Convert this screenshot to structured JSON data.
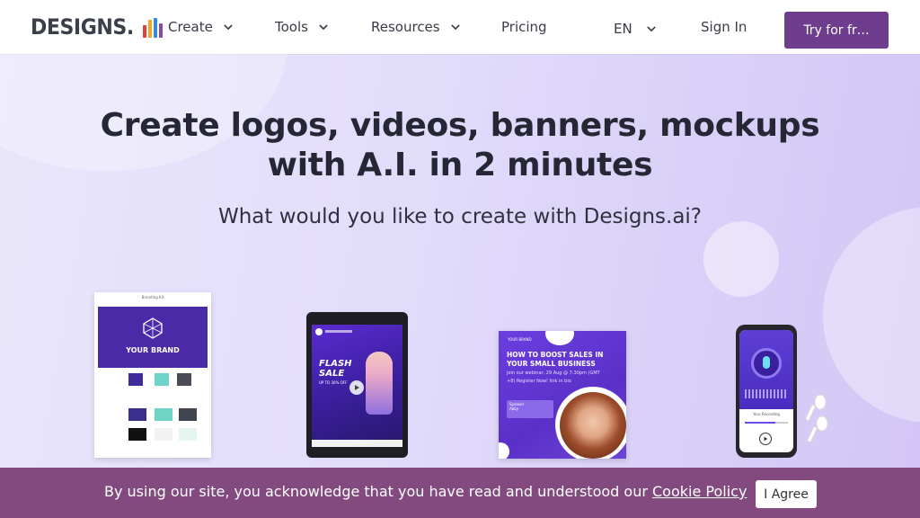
{
  "nav": {
    "logo_text": "DESIGNS.",
    "logo_mark": "Ai",
    "items": [
      {
        "label": "Create",
        "has_dropdown": true
      },
      {
        "label": "Tools",
        "has_dropdown": true
      },
      {
        "label": "Resources",
        "has_dropdown": true
      },
      {
        "label": "Pricing",
        "has_dropdown": false
      }
    ],
    "language": "EN",
    "sign_in": "Sign In",
    "cta": "Try for fr…",
    "cta_color": "#6f3d8e"
  },
  "hero": {
    "title_line1": "Create logos, videos, banners, mockups",
    "title_line2": "with A.I. in 2 minutes",
    "subtitle": "What would you like to create with Designs.ai?",
    "products": {
      "brand_kit": {
        "doc_title": "Branding Kit",
        "brand_label": "YOUR BRAND"
      },
      "video": {
        "headline_1": "FLASH",
        "headline_2": "SALE",
        "sub": "UP TO 30% OFF"
      },
      "banner": {
        "brand": "YOUR BRAND",
        "headline": "HOW TO BOOST SALES IN YOUR SMALL BUSINESS",
        "body": "Join our webinar, 29 Aug @ 7:30pm (GMT +8) Register Now! link in bio",
        "speaker_label": "Speaker",
        "speaker_name": "Abby"
      },
      "audio": {
        "label": "Your Recording"
      }
    }
  },
  "cookie": {
    "text": "By using our site, you acknowledge that you have read and understood our",
    "link": "Cookie Policy",
    "button": "I Agree",
    "bg_color": "#824a7e"
  },
  "colors": {
    "accent": "#6f3d8e",
    "hero_bg": "#e2dcfb",
    "title": "#262735"
  }
}
